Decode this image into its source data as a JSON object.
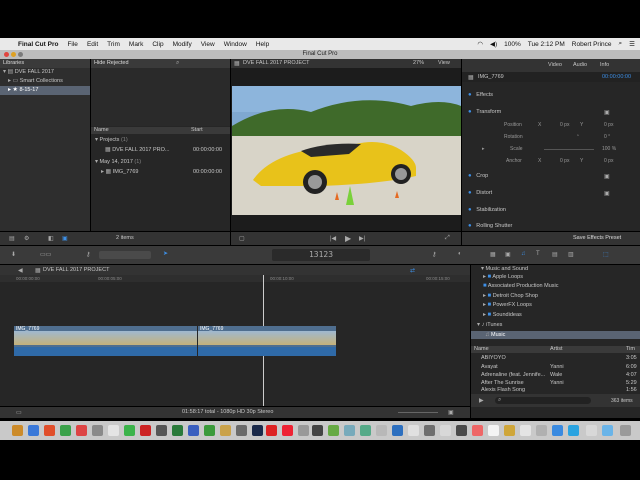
{
  "menubar": {
    "apple": "",
    "app": "Final Cut Pro",
    "items": [
      "File",
      "Edit",
      "Trim",
      "Mark",
      "Clip",
      "Modify",
      "View",
      "Window",
      "Help"
    ],
    "clock": "Tue 2:12 PM",
    "user": "Robert Prince",
    "battery": "100%"
  },
  "window": {
    "title": "Final Cut Pro"
  },
  "library": {
    "header": "Libraries",
    "items": [
      {
        "label": "DVE FALL 2017"
      },
      {
        "label": "Smart Collections"
      },
      {
        "label": "8-15-17"
      }
    ]
  },
  "browser": {
    "filter": "Hide Rejected",
    "col_name": "Name",
    "col_start": "Start",
    "rows": [
      {
        "name": "Projects",
        "count": "(1)",
        "start": ""
      },
      {
        "name": "DVE FALL 2017 PRO...",
        "count": "",
        "start": "00:00:00:00"
      },
      {
        "name": "May 14, 2017",
        "count": "(1)",
        "start": ""
      },
      {
        "name": "IMG_7769",
        "count": "",
        "start": "00:00:00:00"
      }
    ],
    "status": "2 items"
  },
  "viewer": {
    "project": "DVE FALL 2017 PROJECT",
    "zoom": "27%",
    "view": "View"
  },
  "inspector": {
    "tabs": [
      "Video",
      "Audio",
      "Info"
    ],
    "clip": "IMG_7769",
    "timecode": "00:00:00:00",
    "sections": [
      {
        "name": "Effects"
      },
      {
        "name": "Transform"
      },
      {
        "name": "Crop"
      },
      {
        "name": "Distort"
      },
      {
        "name": "Stabilization"
      },
      {
        "name": "Rolling Shutter"
      }
    ],
    "transform": {
      "position": "Position",
      "rotation": "Rotation",
      "scale": "Scale",
      "anchor": "Anchor",
      "x": "X",
      "y": "Y",
      "pos_x": "0 px",
      "pos_y": "0 px",
      "rot": "0 °",
      "scale_val": "100 %",
      "anc_x": "0 px",
      "anc_y": "0 px"
    },
    "save": "Save Effects Preset"
  },
  "toolbar": {
    "timecode": "13123"
  },
  "timeline": {
    "project": "DVE FALL 2017 PROJECT",
    "ruler": [
      "00:00:00:00",
      "00:00:05:00",
      "00:00:10:00",
      "00:00:15:00"
    ],
    "clip1": "IMG_7769",
    "clip2": "IMG_7769",
    "status": "01:58:17 total - 1080p HD 30p Stereo"
  },
  "media": {
    "header": "Music and Sound",
    "items": [
      {
        "label": "Apple Loops"
      },
      {
        "label": "Associated Production Music"
      },
      {
        "label": "Detroit Chop Shop"
      },
      {
        "label": "PowerFX Loops"
      },
      {
        "label": "Soundideas"
      },
      {
        "label": "iTunes"
      },
      {
        "label": "Music"
      }
    ],
    "col_name": "Name",
    "col_artist": "Artist",
    "col_time": "Tim",
    "songs": [
      {
        "name": "ABIYOYO",
        "artist": "",
        "time": "3:05"
      },
      {
        "name": "Avayat",
        "artist": "Yanni",
        "time": "6:09"
      },
      {
        "name": "Adrenaline (feat. Jennife...",
        "artist": "Wale",
        "time": "4:07"
      },
      {
        "name": "After The Sunrise",
        "artist": "Yanni",
        "time": "5:29"
      },
      {
        "name": "Alexis Flash Song",
        "artist": "",
        "time": "1:56"
      }
    ],
    "count": "363 items"
  }
}
